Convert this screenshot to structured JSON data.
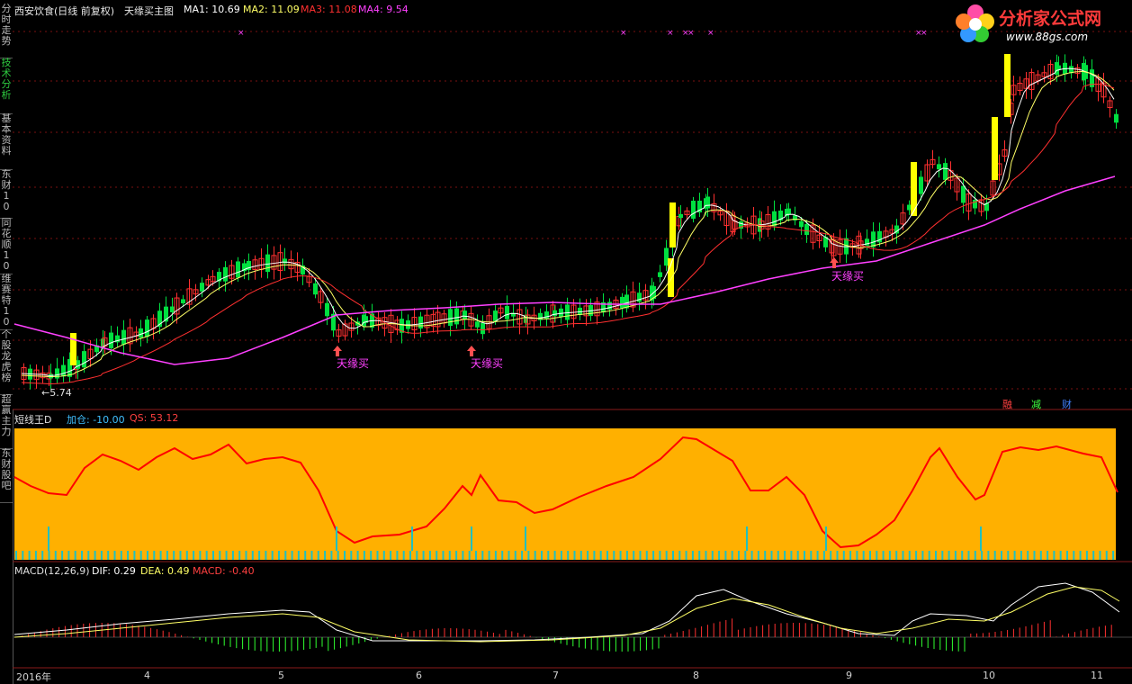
{
  "header": {
    "stock": "西安饮食(日线 前复权)",
    "indicator": "天缘买主图",
    "ma1": "MA1: 10.69",
    "ma2": "MA2: 11.09",
    "ma3": "MA3: 11.08",
    "ma4": "MA4: 9.54"
  },
  "colors": {
    "ma1": "#ffffff",
    "ma2": "#ffff66",
    "ma3": "#ff3030",
    "ma4": "#ff40ff",
    "up": "#ff3030",
    "down": "#00e040",
    "signal_bar": "#ffff00",
    "osc_bg": "#ffb000",
    "osc_line": "#ff0000",
    "osc_ticks": "#20c0c0"
  },
  "sidebar": {
    "tabs": [
      {
        "label": "分时走势"
      },
      {
        "label": "技术分析"
      },
      {
        "label": "基本资料"
      },
      {
        "label": "东财10"
      },
      {
        "label": "同花顺10"
      },
      {
        "label": "维赛特10"
      },
      {
        "label": "个股龙虎榜"
      },
      {
        "label": "超赢主力"
      },
      {
        "label": "东财股吧"
      }
    ]
  },
  "logo": {
    "title": "分析家公式网",
    "url": "www.88gs.com"
  },
  "annotations": {
    "low_price": "←5.74",
    "buy_signal_label": "天缘买"
  },
  "buttons": {
    "b1": "融",
    "b2": "减",
    "b3": "财"
  },
  "oscillator": {
    "name": "短线王D",
    "jiacang": "加仓: -10.00",
    "qs": "QS: 53.12"
  },
  "macd": {
    "name": "MACD(12,26,9)",
    "dif": "DIF: 0.29",
    "dea": "DEA: 0.49",
    "macd": "MACD: -0.40"
  },
  "xaxis": [
    "2016年",
    "4",
    "5",
    "6",
    "7",
    "8",
    "9",
    "10",
    "11"
  ]
}
